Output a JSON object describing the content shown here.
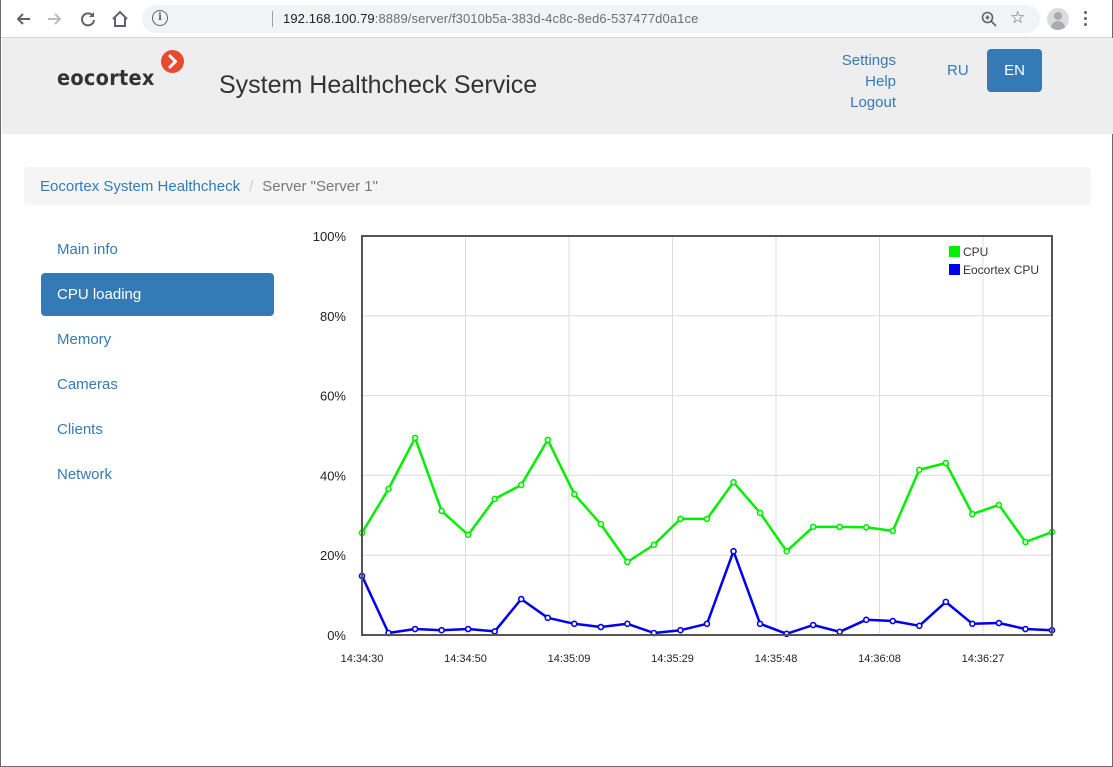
{
  "browser": {
    "url_host": "192.168.100.79",
    "url_rest": ":8889/server/f3010b5a-383d-4c8c-8ed6-537477d0a1ce",
    "icons": [
      "back-icon",
      "forward-icon",
      "reload-icon",
      "home-icon",
      "info-icon",
      "zoom-icon",
      "star-icon",
      "profile-icon",
      "menu-icon"
    ]
  },
  "header": {
    "logo_text": "eocortex",
    "title": "System Healthcheck Service",
    "links": [
      "Settings",
      "Help",
      "Logout"
    ],
    "lang_ru": "RU",
    "lang_en": "EN",
    "active_lang": "EN"
  },
  "breadcrumb": {
    "root": "Eocortex System Healthcheck",
    "divider": "/",
    "current": "Server \"Server 1\""
  },
  "sidebar": {
    "items": [
      {
        "label": "Main info",
        "active": false
      },
      {
        "label": "CPU loading",
        "active": true
      },
      {
        "label": "Memory",
        "active": false
      },
      {
        "label": "Cameras",
        "active": false
      },
      {
        "label": "Clients",
        "active": false
      },
      {
        "label": "Network",
        "active": false
      }
    ]
  },
  "colors": {
    "accent": "#337ab7",
    "cpu": "#00ee00",
    "eocortex_cpu": "#0000ee"
  },
  "chart_data": {
    "type": "line",
    "title": "",
    "xlabel": "",
    "ylabel": "",
    "ylim": [
      0,
      100
    ],
    "yticks": [
      "0%",
      "20%",
      "40%",
      "60%",
      "80%",
      "100%"
    ],
    "ytick_values": [
      0,
      20,
      40,
      60,
      80,
      100
    ],
    "xtick_labels": [
      "14:34:30",
      "14:34:50",
      "14:35:09",
      "14:35:29",
      "14:35:48",
      "14:36:08",
      "14:36:27"
    ],
    "xtick_indices": [
      0,
      3.9,
      7.8,
      11.7,
      15.6,
      19.5,
      23.4
    ],
    "num_points": 27,
    "grid": true,
    "legend_position": "top-right",
    "series": [
      {
        "name": "CPU",
        "color": "#00ee00",
        "values": [
          25.6,
          36.6,
          49.4,
          31.1,
          25.1,
          34.1,
          37.6,
          48.9,
          35.3,
          27.8,
          18.3,
          22.6,
          29.1,
          29.1,
          38.3,
          30.6,
          21.0,
          27.1,
          27.1,
          27.0,
          26.1,
          41.4,
          43.1,
          30.3,
          32.6,
          23.3,
          25.8
        ]
      },
      {
        "name": "Eocortex CPU",
        "color": "#0000ee",
        "values": [
          14.8,
          0.5,
          1.5,
          1.2,
          1.5,
          0.9,
          9.0,
          4.3,
          2.8,
          2.0,
          2.8,
          0.5,
          1.2,
          2.8,
          21.0,
          2.8,
          0.3,
          2.5,
          0.8,
          3.8,
          3.5,
          2.3,
          8.3,
          2.8,
          3.0,
          1.5,
          1.2
        ]
      }
    ]
  }
}
